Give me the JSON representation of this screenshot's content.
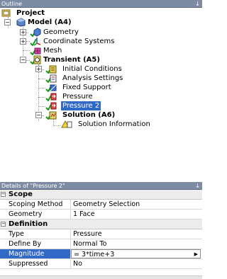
{
  "outline": {
    "title": "Outline",
    "pin": "↓",
    "tree": {
      "project": "Project",
      "model": "Model (A4)",
      "geometry": "Geometry",
      "coordinate_systems": "Coordinate Systems",
      "mesh": "Mesh",
      "transient": "Transient (A5)",
      "initial_conditions": "Initial Conditions",
      "analysis_settings": "Analysis Settings",
      "fixed_support": "Fixed Support",
      "pressure": "Pressure",
      "pressure2": "Pressure 2",
      "solution": "Solution (A6)",
      "solution_information": "Solution Information"
    }
  },
  "details": {
    "title": "Details of \"Pressure 2\"",
    "pin": "↓",
    "sections": [
      {
        "name": "Scope",
        "rows": [
          {
            "key": "Scoping Method",
            "value": "Geometry Selection"
          },
          {
            "key": "Geometry",
            "value": "1 Face"
          }
        ]
      },
      {
        "name": "Definition",
        "rows": [
          {
            "key": "Type",
            "value": "Pressure"
          },
          {
            "key": "Define By",
            "value": "Normal To"
          },
          {
            "key": "Magnitude",
            "value": "= 3*time+3"
          },
          {
            "key": "Suppressed",
            "value": "No"
          }
        ]
      }
    ]
  },
  "colors": {
    "titlebar": "#7d8ca3",
    "selection": "#3169c6"
  }
}
